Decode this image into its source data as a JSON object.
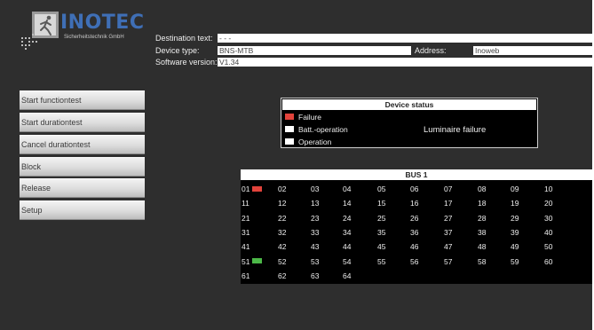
{
  "logo": {
    "brand": "INOTEC",
    "subtitle": "Sicherheitstechnik GmbH",
    "brand_color": "#3f6fb6"
  },
  "info": {
    "destination_label": "Destination text:",
    "destination_value": "- - -",
    "device_type_label": "Device type:",
    "device_type_value": "BNS-MTB",
    "address_label": "Address:",
    "address_value": "Inoweb",
    "software_label": "Software version:",
    "software_value": "V1.34"
  },
  "menu": [
    {
      "label": "Start functiontest"
    },
    {
      "label": "Start durationtest"
    },
    {
      "label": "Cancel durationtest"
    },
    {
      "label": "Block"
    },
    {
      "label": "Release"
    },
    {
      "label": "Setup"
    }
  ],
  "device_status": {
    "title": "Device status",
    "legend": [
      {
        "label": "Failure",
        "color": "#e2433b"
      },
      {
        "label": "Batt.-operation",
        "color": "#ffffff"
      },
      {
        "label": "Operation",
        "color": "#ffffff"
      }
    ],
    "status_text": "Luminaire failure"
  },
  "bus": {
    "title": "BUS 1",
    "cells": [
      {
        "label": "01",
        "indicator": "failure"
      },
      {
        "label": "02"
      },
      {
        "label": "03"
      },
      {
        "label": "04"
      },
      {
        "label": "05"
      },
      {
        "label": "06"
      },
      {
        "label": "07"
      },
      {
        "label": "08"
      },
      {
        "label": "09"
      },
      {
        "label": "10"
      },
      {
        "label": "11"
      },
      {
        "label": "12"
      },
      {
        "label": "13"
      },
      {
        "label": "14"
      },
      {
        "label": "15"
      },
      {
        "label": "16"
      },
      {
        "label": "17"
      },
      {
        "label": "18"
      },
      {
        "label": "19"
      },
      {
        "label": "20"
      },
      {
        "label": "21"
      },
      {
        "label": "22"
      },
      {
        "label": "23"
      },
      {
        "label": "24"
      },
      {
        "label": "25"
      },
      {
        "label": "26"
      },
      {
        "label": "27"
      },
      {
        "label": "28"
      },
      {
        "label": "29"
      },
      {
        "label": "30"
      },
      {
        "label": "31"
      },
      {
        "label": "32"
      },
      {
        "label": "33"
      },
      {
        "label": "34"
      },
      {
        "label": "35"
      },
      {
        "label": "36"
      },
      {
        "label": "37"
      },
      {
        "label": "38"
      },
      {
        "label": "39"
      },
      {
        "label": "40"
      },
      {
        "label": "41"
      },
      {
        "label": "42"
      },
      {
        "label": "43"
      },
      {
        "label": "44"
      },
      {
        "label": "45"
      },
      {
        "label": "46"
      },
      {
        "label": "47"
      },
      {
        "label": "48"
      },
      {
        "label": "49"
      },
      {
        "label": "50"
      },
      {
        "label": "51",
        "indicator": "ok"
      },
      {
        "label": "52"
      },
      {
        "label": "53"
      },
      {
        "label": "54"
      },
      {
        "label": "55"
      },
      {
        "label": "56"
      },
      {
        "label": "57"
      },
      {
        "label": "58"
      },
      {
        "label": "59"
      },
      {
        "label": "60"
      },
      {
        "label": "61"
      },
      {
        "label": "62"
      },
      {
        "label": "63"
      },
      {
        "label": "64"
      }
    ],
    "indicator_colors": {
      "failure": "#e2433b",
      "ok": "#4cb848"
    }
  }
}
